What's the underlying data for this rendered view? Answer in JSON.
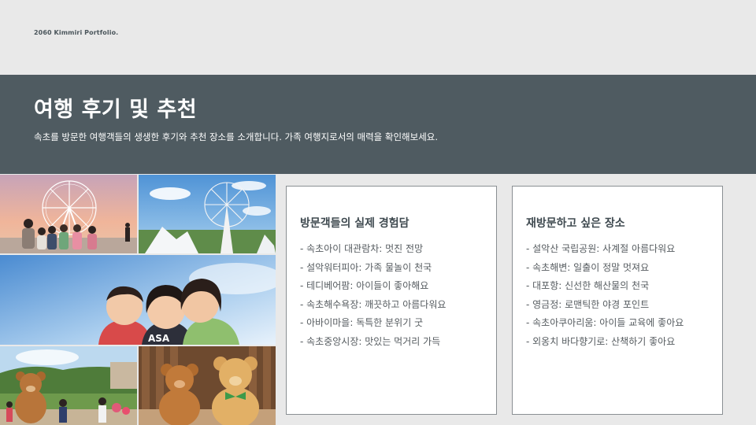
{
  "brand": "2060 Kimmiri Portfolio.",
  "banner": {
    "title": "여행 후기 및 추천",
    "subtitle": "속초를 방문한 여행객들의 생생한 후기와 추천 장소를 소개합니다. 가족 여행지로서의 매력을 확인해보세요."
  },
  "photos": {
    "p1": "",
    "p2": "",
    "p3": "",
    "p4": "",
    "p5": "",
    "shirt_text": "ASA"
  },
  "experiences": {
    "title": "방문객들의 실제 경험담",
    "items": [
      "- 속초아이 대관람차: 멋진 전망",
      "- 설악워터피아: 가족 물놀이 천국",
      "- 테디베어팜: 아이들이 좋아해요",
      "- 속초해수욕장: 깨끗하고 아름다워요",
      "- 아바이마을: 독특한 분위기 굿",
      "- 속초중앙시장: 맛있는 먹거리 가득"
    ]
  },
  "revisit": {
    "title": "재방문하고 싶은 장소",
    "items": [
      "- 설악산 국립공원: 사계절 아름다워요",
      "- 속초해변: 일출이 정말 멋져요",
      "- 대포항: 신선한 해산물의 천국",
      "- 영금정: 로맨틱한 야경 포인트",
      "- 속초아쿠아리움: 아이들 교육에 좋아요",
      "- 외옹치 바다향기로: 산책하기 좋아요"
    ]
  },
  "colors": {
    "banner": "#4f5b61",
    "background": "#e9e9e9",
    "card_border": "#8a8f93"
  }
}
